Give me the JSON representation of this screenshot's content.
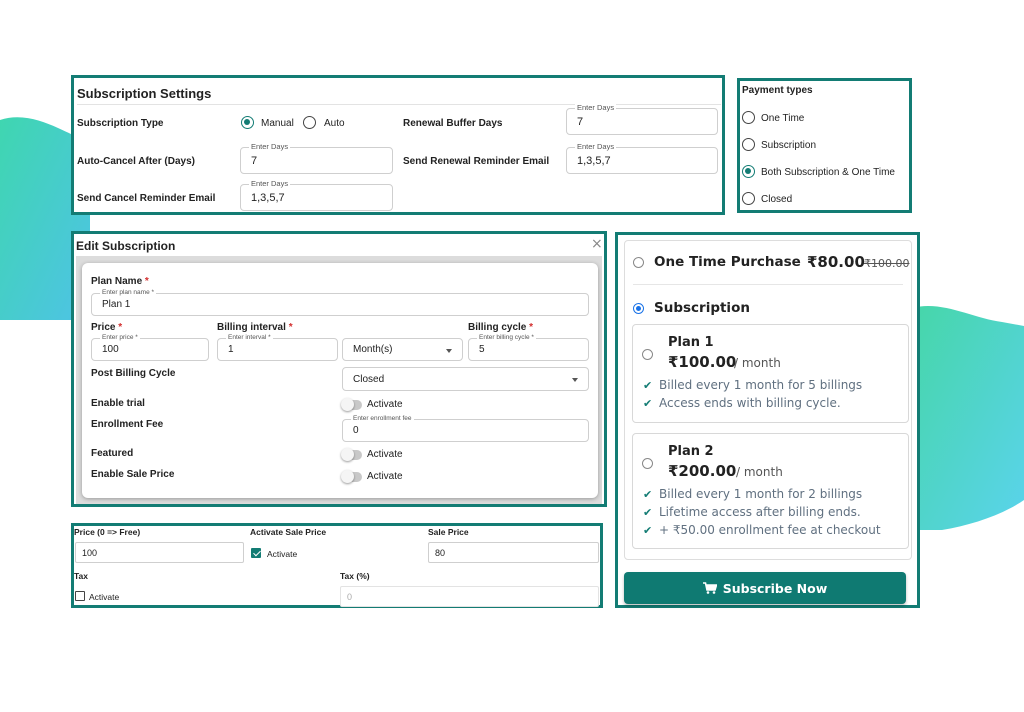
{
  "subscription_settings": {
    "title": "Subscription Settings",
    "subscription_type_label": "Subscription Type",
    "manual_label": "Manual",
    "auto_label": "Auto",
    "renewal_buffer_label": "Renewal Buffer Days",
    "renewal_buffer_legend": "Enter Days",
    "renewal_buffer_value": "7",
    "auto_cancel_label": "Auto-Cancel After (Days)",
    "auto_cancel_legend": "Enter Days",
    "auto_cancel_value": "7",
    "renewal_reminder_label": "Send Renewal Reminder Email",
    "renewal_reminder_legend": "Enter Days",
    "renewal_reminder_value": "1,3,5,7",
    "cancel_reminder_label": "Send Cancel Reminder Email",
    "cancel_reminder_legend": "Enter Days",
    "cancel_reminder_value": "1,3,5,7"
  },
  "payment_types": {
    "title": "Payment types",
    "options": [
      "One Time",
      "Subscription",
      "Both Subscription & One Time",
      "Closed"
    ],
    "selected": "Both Subscription & One Time"
  },
  "edit_subscription": {
    "title": "Edit Subscription",
    "close_icon": "close-icon",
    "plan_name_label": "Plan Name",
    "plan_name_legend": "Enter plan name *",
    "plan_name_value": "Plan 1",
    "price_label": "Price",
    "price_legend": "Enter price *",
    "price_value": "100",
    "billing_interval_label": "Billing interval",
    "interval_legend": "Enter interval *",
    "interval_value": "1",
    "interval_unit": "Month(s)",
    "billing_cycle_label": "Billing cycle",
    "billing_cycle_legend": "Enter billing cycle *",
    "billing_cycle_value": "5",
    "post_billing_label": "Post Billing Cycle",
    "post_billing_value": "Closed",
    "enable_trial_label": "Enable trial",
    "activate_label": "Activate",
    "enrollment_fee_label": "Enrollment Fee",
    "enrollment_fee_legend": "Enter enrollment fee",
    "enrollment_fee_value": "0",
    "featured_label": "Featured",
    "enable_sale_label": "Enable Sale Price",
    "required_mark": "*"
  },
  "sale_price_panel": {
    "price_label": "Price (0 => Free)",
    "price_value": "100",
    "activate_sale_label": "Activate Sale Price",
    "activate_label": "Activate",
    "sale_price_label": "Sale Price",
    "sale_price_value": "80",
    "tax_label": "Tax",
    "tax_activate_label": "Activate",
    "tax_percent_label": "Tax (%)",
    "tax_percent_placeholder": "0"
  },
  "checkout": {
    "one_time_label": "One Time Purchase",
    "one_time_price": "₹80.00",
    "one_time_old_price": "₹100.00",
    "subscription_label": "Subscription",
    "plans": [
      {
        "name": "Plan 1",
        "price": "₹100.00",
        "period": "/ month",
        "features": [
          "Billed every 1 month for 5 billings",
          "Access ends with billing cycle."
        ]
      },
      {
        "name": "Plan 2",
        "price": "₹200.00",
        "period": "/ month",
        "features": [
          "Billed every 1 month for 2 billings",
          "Lifetime access after billing ends.",
          "+ ₹50.00 enrollment fee at checkout"
        ]
      }
    ],
    "subscribe_button": "Subscribe Now",
    "cart_icon": "cart-icon"
  },
  "colors": {
    "accent": "#137c74",
    "button": "#0f7a72",
    "radio_blue": "#1a73e8"
  }
}
